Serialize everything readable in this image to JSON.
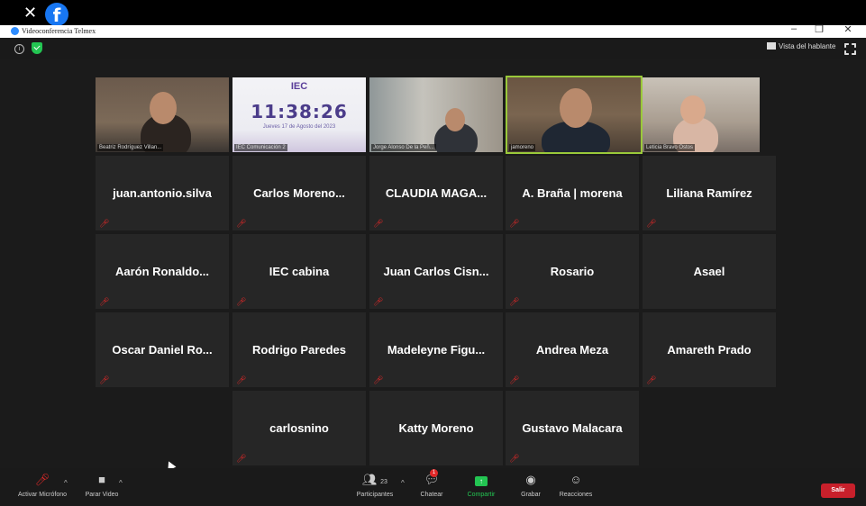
{
  "window": {
    "title": "Videoconferencia Telmex",
    "minimize": "–",
    "restore": "❐",
    "close": "✕"
  },
  "overlay": {
    "close": "✕",
    "facebook": "f"
  },
  "meeting_bar": {
    "info": "i",
    "speaker_view": "Vista del hablante"
  },
  "video_tiles": [
    {
      "label": "Beatriz Rodríguez Villan..."
    },
    {
      "label": "IEC Comunicación 2",
      "logo": "IEC",
      "clock": "11:38:26",
      "date": "Jueves 17 de Agosto del 2023"
    },
    {
      "label": "Jorge Alonso De la Peñ..."
    },
    {
      "label": "jamoreno"
    },
    {
      "label": "Leticia Bravo Ostos"
    }
  ],
  "name_tiles": [
    [
      "juan.antonio.silva",
      "Carlos  Moreno...",
      "CLAUDIA  MAGA...",
      "A. Braña | morena",
      "Liliana Ramírez"
    ],
    [
      "Aarón  Ronaldo...",
      "IEC cabina",
      "Juan Carlos Cisn...",
      "Rosario",
      "Asael"
    ],
    [
      "Oscar  Daniel Ro...",
      "Rodrigo Paredes",
      "Madeleyne  Figu...",
      "Andrea Meza",
      "Amareth Prado"
    ],
    [
      "carlosnino",
      "Katty Moreno",
      "Gustavo Malacara"
    ]
  ],
  "toolbar": {
    "mic_label": "Activar Micrófono",
    "video_label": "Parar Video",
    "participants_label": "Participantes",
    "participants_count": "23",
    "chat_label": "Chatear",
    "chat_badge": "1",
    "share_label": "Compartir",
    "record_label": "Grabar",
    "reactions_label": "Reacciones",
    "leave_label": "Salir"
  },
  "colors": {
    "share_green": "#23c552",
    "leave_red": "#c8202b",
    "active_speaker": "#9ac93a"
  }
}
